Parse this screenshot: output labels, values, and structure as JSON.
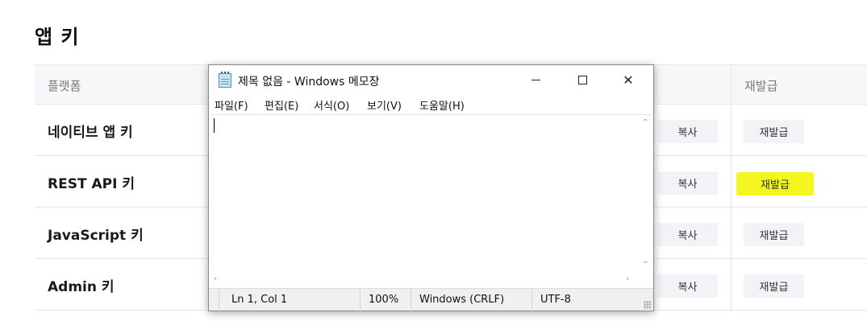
{
  "page": {
    "title": "앱 키"
  },
  "table": {
    "header_platform": "플랫폼",
    "header_reissue": "재발급",
    "rows": [
      {
        "label": "네이티브 앱 키",
        "copy": "복사",
        "reissue": "재발급"
      },
      {
        "label": "REST API 키",
        "copy": "복사",
        "reissue": "재발급",
        "highlighted": true
      },
      {
        "label": "JavaScript 키",
        "copy": "복사",
        "reissue": "재발급"
      },
      {
        "label": "Admin 키",
        "copy": "복사",
        "reissue": "재발급"
      }
    ]
  },
  "notepad": {
    "title": "제목 없음 - Windows 메모장",
    "icon": "notepad-icon",
    "menu": [
      "파일(F)",
      "편집(E)",
      "서식(O)",
      "보기(V)",
      "도움말(H)"
    ],
    "content": "",
    "status": {
      "position": "Ln 1, Col 1",
      "zoom": "100%",
      "line_ending": "Windows (CRLF)",
      "encoding": "UTF-8"
    }
  },
  "colors": {
    "highlight": "#f5f51f",
    "button_bg": "#f2f3f7",
    "header_bg": "#f6f7f8"
  }
}
